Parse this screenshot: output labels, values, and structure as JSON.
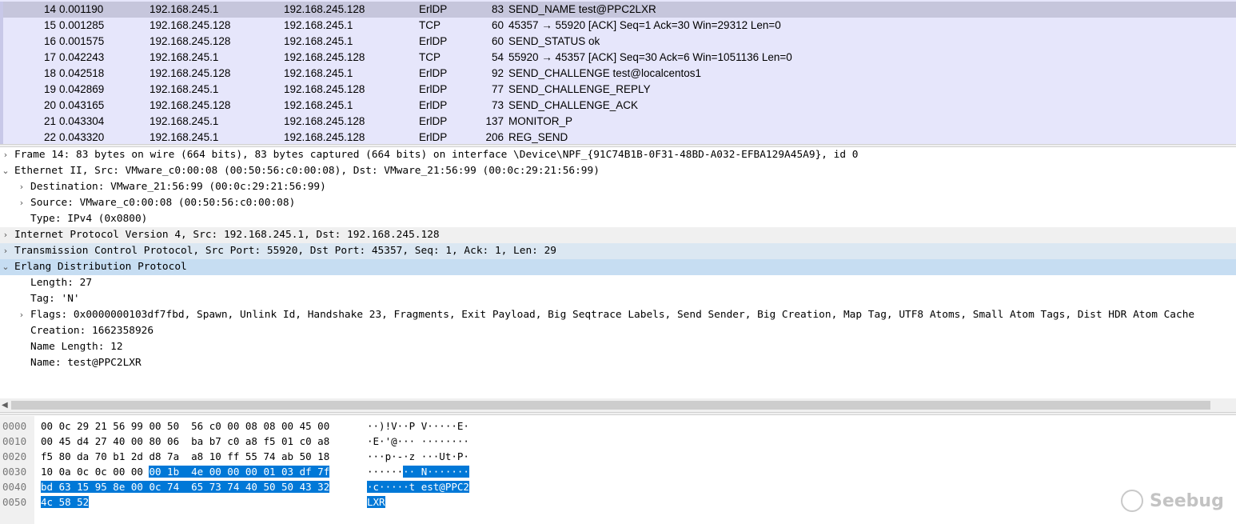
{
  "packets": [
    {
      "no": "14",
      "time": "0.001190",
      "src": "192.168.245.1",
      "dst": "192.168.245.128",
      "proto": "ErlDP",
      "len": "83",
      "info": "SEND_NAME test@PPC2LXR",
      "selected": true
    },
    {
      "no": "15",
      "time": "0.001285",
      "src": "192.168.245.128",
      "dst": "192.168.245.1",
      "proto": "TCP",
      "len": "60",
      "info": "45357 → 55920 [ACK] Seq=1 Ack=30 Win=29312 Len=0"
    },
    {
      "no": "16",
      "time": "0.001575",
      "src": "192.168.245.128",
      "dst": "192.168.245.1",
      "proto": "ErlDP",
      "len": "60",
      "info": "SEND_STATUS ok"
    },
    {
      "no": "17",
      "time": "0.042243",
      "src": "192.168.245.1",
      "dst": "192.168.245.128",
      "proto": "TCP",
      "len": "54",
      "info": "55920 → 45357 [ACK] Seq=30 Ack=6 Win=1051136 Len=0"
    },
    {
      "no": "18",
      "time": "0.042518",
      "src": "192.168.245.128",
      "dst": "192.168.245.1",
      "proto": "ErlDP",
      "len": "92",
      "info": "SEND_CHALLENGE test@localcentos1"
    },
    {
      "no": "19",
      "time": "0.042869",
      "src": "192.168.245.1",
      "dst": "192.168.245.128",
      "proto": "ErlDP",
      "len": "77",
      "info": "SEND_CHALLENGE_REPLY"
    },
    {
      "no": "20",
      "time": "0.043165",
      "src": "192.168.245.128",
      "dst": "192.168.245.1",
      "proto": "ErlDP",
      "len": "73",
      "info": "SEND_CHALLENGE_ACK"
    },
    {
      "no": "21",
      "time": "0.043304",
      "src": "192.168.245.1",
      "dst": "192.168.245.128",
      "proto": "ErlDP",
      "len": "137",
      "info": "MONITOR_P"
    },
    {
      "no": "22",
      "time": "0.043320",
      "src": "192.168.245.1",
      "dst": "192.168.245.128",
      "proto": "ErlDP",
      "len": "206",
      "info": "REG_SEND"
    }
  ],
  "tree": [
    {
      "indent": 0,
      "arrow": "›",
      "style": "",
      "text": "Frame 14: 83 bytes on wire (664 bits), 83 bytes captured (664 bits) on interface \\Device\\NPF_{91C74B1B-0F31-48BD-A032-EFBA129A45A9}, id 0"
    },
    {
      "indent": 0,
      "arrow": "⌄",
      "style": "",
      "text": "Ethernet II, Src: VMware_c0:00:08 (00:50:56:c0:00:08), Dst: VMware_21:56:99 (00:0c:29:21:56:99)"
    },
    {
      "indent": 1,
      "arrow": "›",
      "style": "",
      "text": "Destination: VMware_21:56:99 (00:0c:29:21:56:99)"
    },
    {
      "indent": 1,
      "arrow": "›",
      "style": "",
      "text": "Source: VMware_c0:00:08 (00:50:56:c0:00:08)"
    },
    {
      "indent": 1,
      "arrow": "",
      "style": "",
      "text": "Type: IPv4 (0x0800)"
    },
    {
      "indent": 0,
      "arrow": "›",
      "style": "shade",
      "text": "Internet Protocol Version 4, Src: 192.168.245.1, Dst: 192.168.245.128"
    },
    {
      "indent": 0,
      "arrow": "›",
      "style": "blue",
      "text": "Transmission Control Protocol, Src Port: 55920, Dst Port: 45357, Seq: 1, Ack: 1, Len: 29"
    },
    {
      "indent": 0,
      "arrow": "⌄",
      "style": "sel",
      "text": "Erlang Distribution Protocol"
    },
    {
      "indent": 1,
      "arrow": "",
      "style": "",
      "text": "Length: 27"
    },
    {
      "indent": 1,
      "arrow": "",
      "style": "",
      "text": "Tag: 'N'"
    },
    {
      "indent": 1,
      "arrow": "›",
      "style": "",
      "text": "Flags: 0x0000000103df7fbd, Spawn, Unlink Id, Handshake 23, Fragments, Exit Payload, Big Seqtrace Labels, Send Sender, Big Creation, Map Tag, UTF8 Atoms, Small Atom Tags, Dist HDR Atom Cache"
    },
    {
      "indent": 1,
      "arrow": "",
      "style": "",
      "text": "Creation: 1662358926"
    },
    {
      "indent": 1,
      "arrow": "",
      "style": "",
      "text": "Name Length: 12"
    },
    {
      "indent": 1,
      "arrow": "",
      "style": "",
      "text": "Name: test@PPC2LXR"
    }
  ],
  "hex": [
    {
      "offset": "0000",
      "bytes_plain": "00 0c 29 21 56 99 00 50  56 c0 00 08 08 00 45 00",
      "bytes_hl": "",
      "ascii_plain": "··)!V··P V·····E·",
      "ascii_hl": ""
    },
    {
      "offset": "0010",
      "bytes_plain": "00 45 d4 27 40 00 80 06  ba b7 c0 a8 f5 01 c0 a8",
      "bytes_hl": "",
      "ascii_plain": "·E·'@··· ········",
      "ascii_hl": ""
    },
    {
      "offset": "0020",
      "bytes_plain": "f5 80 da 70 b1 2d d8 7a  a8 10 ff 55 74 ab 50 18",
      "bytes_hl": "",
      "ascii_plain": "···p·-·z ···Ut·P·",
      "ascii_hl": ""
    },
    {
      "offset": "0030",
      "bytes_plain": "10 0a 0c 0c 00 00 ",
      "bytes_hl": "00 1b  4e 00 00 00 01 03 df 7f",
      "ascii_plain": "······",
      "ascii_hl": "·· N·······"
    },
    {
      "offset": "0040",
      "bytes_plain": "",
      "bytes_hl": "bd 63 15 95 8e 00 0c 74  65 73 74 40 50 50 43 32",
      "ascii_plain": "",
      "ascii_hl": "·c·····t est@PPC2"
    },
    {
      "offset": "0050",
      "bytes_plain": "",
      "bytes_hl": "4c 58 52",
      "ascii_plain": "",
      "ascii_hl": "LXR"
    }
  ],
  "watermark": {
    "text": "Seebug"
  },
  "colors": {
    "selection_blue": "#0078d7",
    "packet_bg": "#e6e6fb",
    "tree_selected": "#c6ddf2"
  }
}
